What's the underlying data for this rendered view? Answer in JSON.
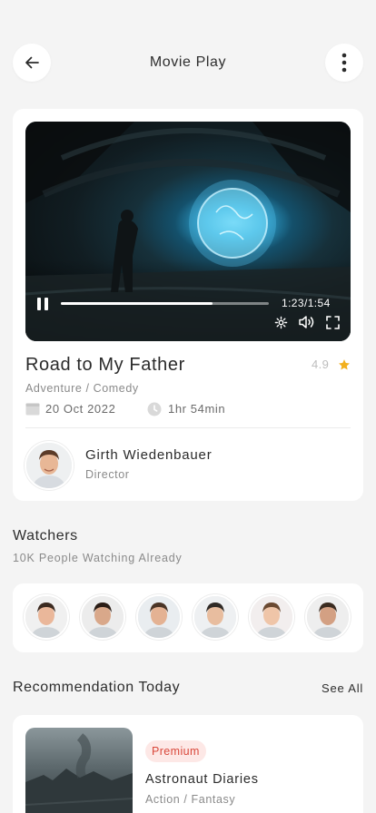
{
  "header": {
    "title": "Movie Play"
  },
  "player": {
    "time": "1:23/1:54",
    "progress": 0.73
  },
  "movie": {
    "title": "Road to My Father",
    "rating": "4.9",
    "genre": "Adventure / Comedy",
    "date": "20 Oct 2022",
    "duration": "1hr 54min"
  },
  "director": {
    "name": "Girth Wiedenbauer",
    "role": "Director"
  },
  "watchers": {
    "title": "Watchers",
    "subtitle": "10K People Watching Already",
    "avatars": [
      {
        "name": "watcher-1"
      },
      {
        "name": "watcher-2"
      },
      {
        "name": "watcher-3"
      },
      {
        "name": "watcher-4"
      },
      {
        "name": "watcher-5"
      },
      {
        "name": "watcher-6"
      }
    ]
  },
  "recommendation": {
    "title": "Recommendation Today",
    "see_all": "See All",
    "items": [
      {
        "badge": "Premium",
        "title": "Astronaut Diaries",
        "genre": "Action / Fantasy"
      }
    ]
  },
  "colors": {
    "star": "#f2b01e",
    "badge_bg": "#fde8e6",
    "badge_text": "#d9483b"
  }
}
